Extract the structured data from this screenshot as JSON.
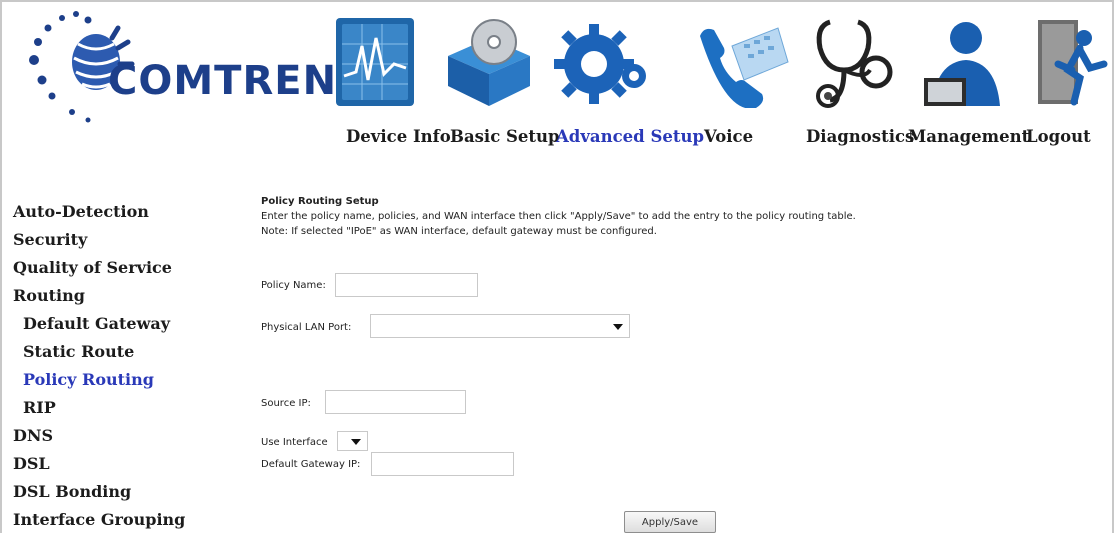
{
  "brand": {
    "name": "COMTREND"
  },
  "nav": {
    "items": [
      {
        "label": "Device Info",
        "icon": "pulse-monitor-icon"
      },
      {
        "label": "Basic Setup",
        "icon": "box-disc-icon"
      },
      {
        "label": "Advanced Setup",
        "icon": "gears-icon",
        "active": true
      },
      {
        "label": "Voice",
        "icon": "phone-icon"
      },
      {
        "label": "Diagnostics",
        "icon": "stethoscope-icon"
      },
      {
        "label": "Management",
        "icon": "user-laptop-icon"
      },
      {
        "label": "Logout",
        "icon": "exit-door-icon"
      }
    ]
  },
  "sidebar": {
    "items": [
      {
        "label": "Auto-Detection"
      },
      {
        "label": "Security"
      },
      {
        "label": "Quality of Service"
      },
      {
        "label": "Routing"
      },
      {
        "label": "Default Gateway",
        "sub": true
      },
      {
        "label": "Static Route",
        "sub": true
      },
      {
        "label": "Policy Routing",
        "sub": true,
        "active": true
      },
      {
        "label": "RIP",
        "sub": true
      },
      {
        "label": "DNS"
      },
      {
        "label": "DSL"
      },
      {
        "label": "DSL Bonding"
      },
      {
        "label": "Interface Grouping"
      }
    ]
  },
  "content": {
    "title": "Policy Routing Setup",
    "description": "Enter the policy name, policies, and WAN interface then click \"Apply/Save\" to add the entry to the policy routing table.",
    "note": "Note: If selected \"IPoE\" as WAN interface, default gateway must be configured.",
    "policy_name_label": "Policy Name:",
    "policy_name_value": "",
    "lan_port_label": "Physical LAN Port:",
    "lan_port_value": "",
    "source_ip_label": "Source IP:",
    "source_ip_value": "",
    "use_interface_label": "Use Interface",
    "use_interface_value": "",
    "gateway_label": "Default Gateway IP:",
    "gateway_value": "",
    "apply_label": "Apply/Save"
  },
  "colors": {
    "brand": "#1d3f8a",
    "active": "#2a39b8",
    "text": "#1c1c1c"
  }
}
